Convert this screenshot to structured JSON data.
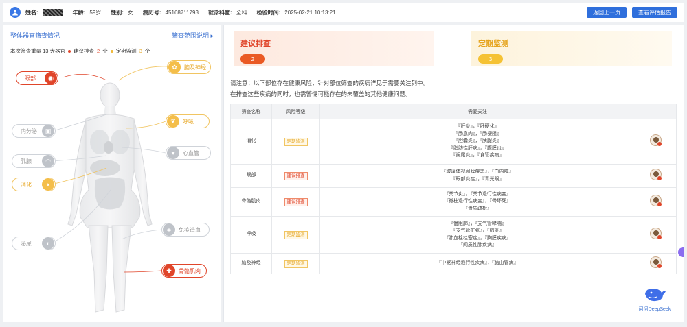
{
  "header": {
    "name_label": "姓名:",
    "age_label": "年龄:",
    "age": "59岁",
    "sex_label": "性别:",
    "sex": "女",
    "record_label": "病历号:",
    "record": "45168711793",
    "dept_label": "就诊科室:",
    "dept": "全科",
    "time_label": "检验时间:",
    "time": "2025-02-21 10:13:21",
    "back_btn": "返回上一页",
    "report_btn": "查看评估报告"
  },
  "left": {
    "title": "整体器官筛查情况",
    "range_link": "筛查范围说明 ▸",
    "summary_prefix": "本次筛查重量 13 大器官",
    "suggest_label": "建议排查",
    "suggest_count": "2",
    "suggest_unit": "个",
    "monitor_label": "定期监测",
    "monitor_count": "3",
    "monitor_unit": "个",
    "organs": [
      {
        "label": "眼部",
        "icon": "eye-icon",
        "status": "red"
      },
      {
        "label": "脑及神经",
        "icon": "brain-icon",
        "status": "yellow"
      },
      {
        "label": "内分泌",
        "icon": "endocrine-icon",
        "status": "gray"
      },
      {
        "label": "呼吸",
        "icon": "lung-icon",
        "status": "yellow"
      },
      {
        "label": "心血管",
        "icon": "heart-icon",
        "status": "gray"
      },
      {
        "label": "乳腺",
        "icon": "breast-icon",
        "status": "gray"
      },
      {
        "label": "消化",
        "icon": "stomach-icon",
        "status": "yellow"
      },
      {
        "label": "免疫造血",
        "icon": "blood-icon",
        "status": "gray"
      },
      {
        "label": "泌尿",
        "icon": "kidney-icon",
        "status": "gray"
      },
      {
        "label": "骨骼肌肉",
        "icon": "bone-icon",
        "status": "red"
      }
    ]
  },
  "right": {
    "card_suggest": {
      "title": "建议排查",
      "count": "2"
    },
    "card_monitor": {
      "title": "定期监测",
      "count": "3"
    },
    "notice_line1": "请注意：以下部位存在健康风险，针对部位筛查的疾病详见于需要关注列中。",
    "notice_line2": "在排查这些疾病的同时，也需警惕可能存在的未覆盖的其他健康问题。",
    "table": {
      "headers": [
        "筛查名称",
        "风险等级",
        "需要关注"
      ],
      "rows": [
        {
          "name": "消化",
          "risk": "定期监测",
          "level": "yellow",
          "items": [
            "『肝炎』，『肝硬化』",
            "『肠息肉』，『肠梗阻』",
            "『胆囊炎』，『胰腺炎』",
            "『脂肪性肝病』，『腹膜炎』",
            "『阑尾炎』，『食管疾病』"
          ]
        },
        {
          "name": "眼部",
          "risk": "建议排查",
          "level": "red",
          "items": [
            "『玻璃体视网膜疾患』，『白内障』",
            "『眼部炎症』，『青光眼』"
          ]
        },
        {
          "name": "骨骼肌肉",
          "risk": "建议排查",
          "level": "red",
          "items": [
            "『关节炎』，『关节退行性病变』",
            "『脊柱退行性病变』，『骨坏死』",
            "『骨质疏松』"
          ]
        },
        {
          "name": "呼吸",
          "risk": "定期监测",
          "level": "yellow",
          "items": [
            "『慢阻肺』，『支气管哮喘』",
            "『支气管扩张』，『肺炎』",
            "『肺血栓栓塞症』，『胸膜疾病』",
            "『间质性肺疾病』"
          ]
        },
        {
          "name": "脑及神经",
          "risk": "定期监测",
          "level": "yellow",
          "items": [
            "『中枢神经退行性疾病』，『脑血管病』"
          ]
        }
      ]
    },
    "deepseek_label": "问问DeepSeek"
  },
  "colors": {
    "accent": "#2f6fdc",
    "red": "#e0452a",
    "yellow": "#e6a520"
  }
}
